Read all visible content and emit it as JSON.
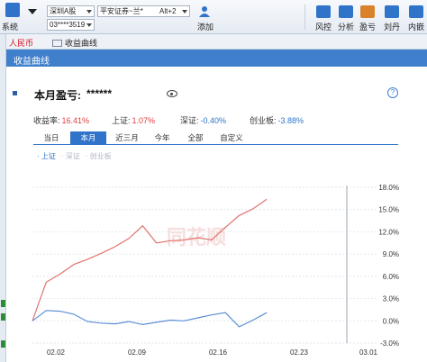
{
  "toolbar": {
    "system_label": "系统",
    "market_select": "深圳A股",
    "broker_select": "平安证券~兰*",
    "hotkey": "Alt+2",
    "account_select": "03****3519",
    "add_label": "添加",
    "buttons": [
      {
        "label": "风控",
        "icon": "shield-icon",
        "color": "#2f74c8"
      },
      {
        "label": "分析",
        "icon": "analysis-icon",
        "color": "#2f74c8"
      },
      {
        "label": "盈亏",
        "icon": "profit-icon",
        "color": "#d9822b"
      },
      {
        "label": "刘丹",
        "icon": "user-icon",
        "color": "#2f74c8"
      },
      {
        "label": "内嵌",
        "icon": "embed-icon",
        "color": "#2f74c8"
      }
    ]
  },
  "tabstrip": {
    "currency_tab": "人民币",
    "chart_tab": "收益曲线"
  },
  "dialog": {
    "title": "收益曲线"
  },
  "summary": {
    "title": "本月盈亏:",
    "masked_value": "******",
    "help": "?",
    "stats": [
      {
        "label": "收益率:",
        "value": "16.41%",
        "color": "#e0403a"
      },
      {
        "label": "上证:",
        "value": "1.07%",
        "color": "#e0403a"
      },
      {
        "label": "深证:",
        "value": "-0.40%",
        "color": "#2f74c8"
      },
      {
        "label": "创业板:",
        "value": "-3.88%",
        "color": "#2f74c8"
      }
    ]
  },
  "period_tabs": [
    "当日",
    "本月",
    "近三月",
    "今年",
    "全部",
    "自定义"
  ],
  "active_period": 1,
  "legend": [
    {
      "label": "· 上证",
      "color": "#2f74c8"
    },
    {
      "label": "· 深证",
      "color": "#b0b8c4"
    },
    {
      "label": "· 创业板",
      "color": "#b0b8c4"
    }
  ],
  "watermark": "同花顺",
  "chart_data": {
    "type": "line",
    "x_ticks": [
      "02.02",
      "02.09",
      "02.16",
      "02.23",
      "03.01"
    ],
    "y_ticks": [
      "18.0%",
      "15.0%",
      "12.0%",
      "9.0%",
      "6.0%",
      "3.0%",
      "0.0%",
      "-3.0%"
    ],
    "ylim": [
      -3.0,
      18.0
    ],
    "series": [
      {
        "color": "#e0746e",
        "points": [
          [
            0,
            0.0
          ],
          [
            1,
            5.2
          ],
          [
            2,
            6.3
          ],
          [
            3,
            7.6
          ],
          [
            4,
            8.3
          ],
          [
            5,
            9.1
          ],
          [
            6,
            10.0
          ],
          [
            7,
            11.1
          ],
          [
            8,
            12.8
          ],
          [
            9,
            10.5
          ],
          [
            10,
            10.8
          ],
          [
            11,
            10.9
          ],
          [
            12,
            11.2
          ],
          [
            13,
            10.9
          ],
          [
            14,
            12.6
          ],
          [
            15,
            14.2
          ],
          [
            16,
            15.1
          ],
          [
            17,
            16.4
          ]
        ]
      },
      {
        "color": "#5b8fd6",
        "points": [
          [
            0,
            0.0
          ],
          [
            1,
            1.4
          ],
          [
            2,
            1.3
          ],
          [
            3,
            0.9
          ],
          [
            4,
            -0.1
          ],
          [
            5,
            -0.3
          ],
          [
            6,
            -0.4
          ],
          [
            7,
            -0.1
          ],
          [
            8,
            -0.5
          ],
          [
            9,
            -0.2
          ],
          [
            10,
            0.1
          ],
          [
            11,
            0.0
          ],
          [
            12,
            0.4
          ],
          [
            13,
            0.8
          ],
          [
            14,
            1.1
          ],
          [
            15,
            -0.8
          ],
          [
            16,
            0.1
          ],
          [
            17,
            1.1
          ]
        ]
      }
    ]
  }
}
